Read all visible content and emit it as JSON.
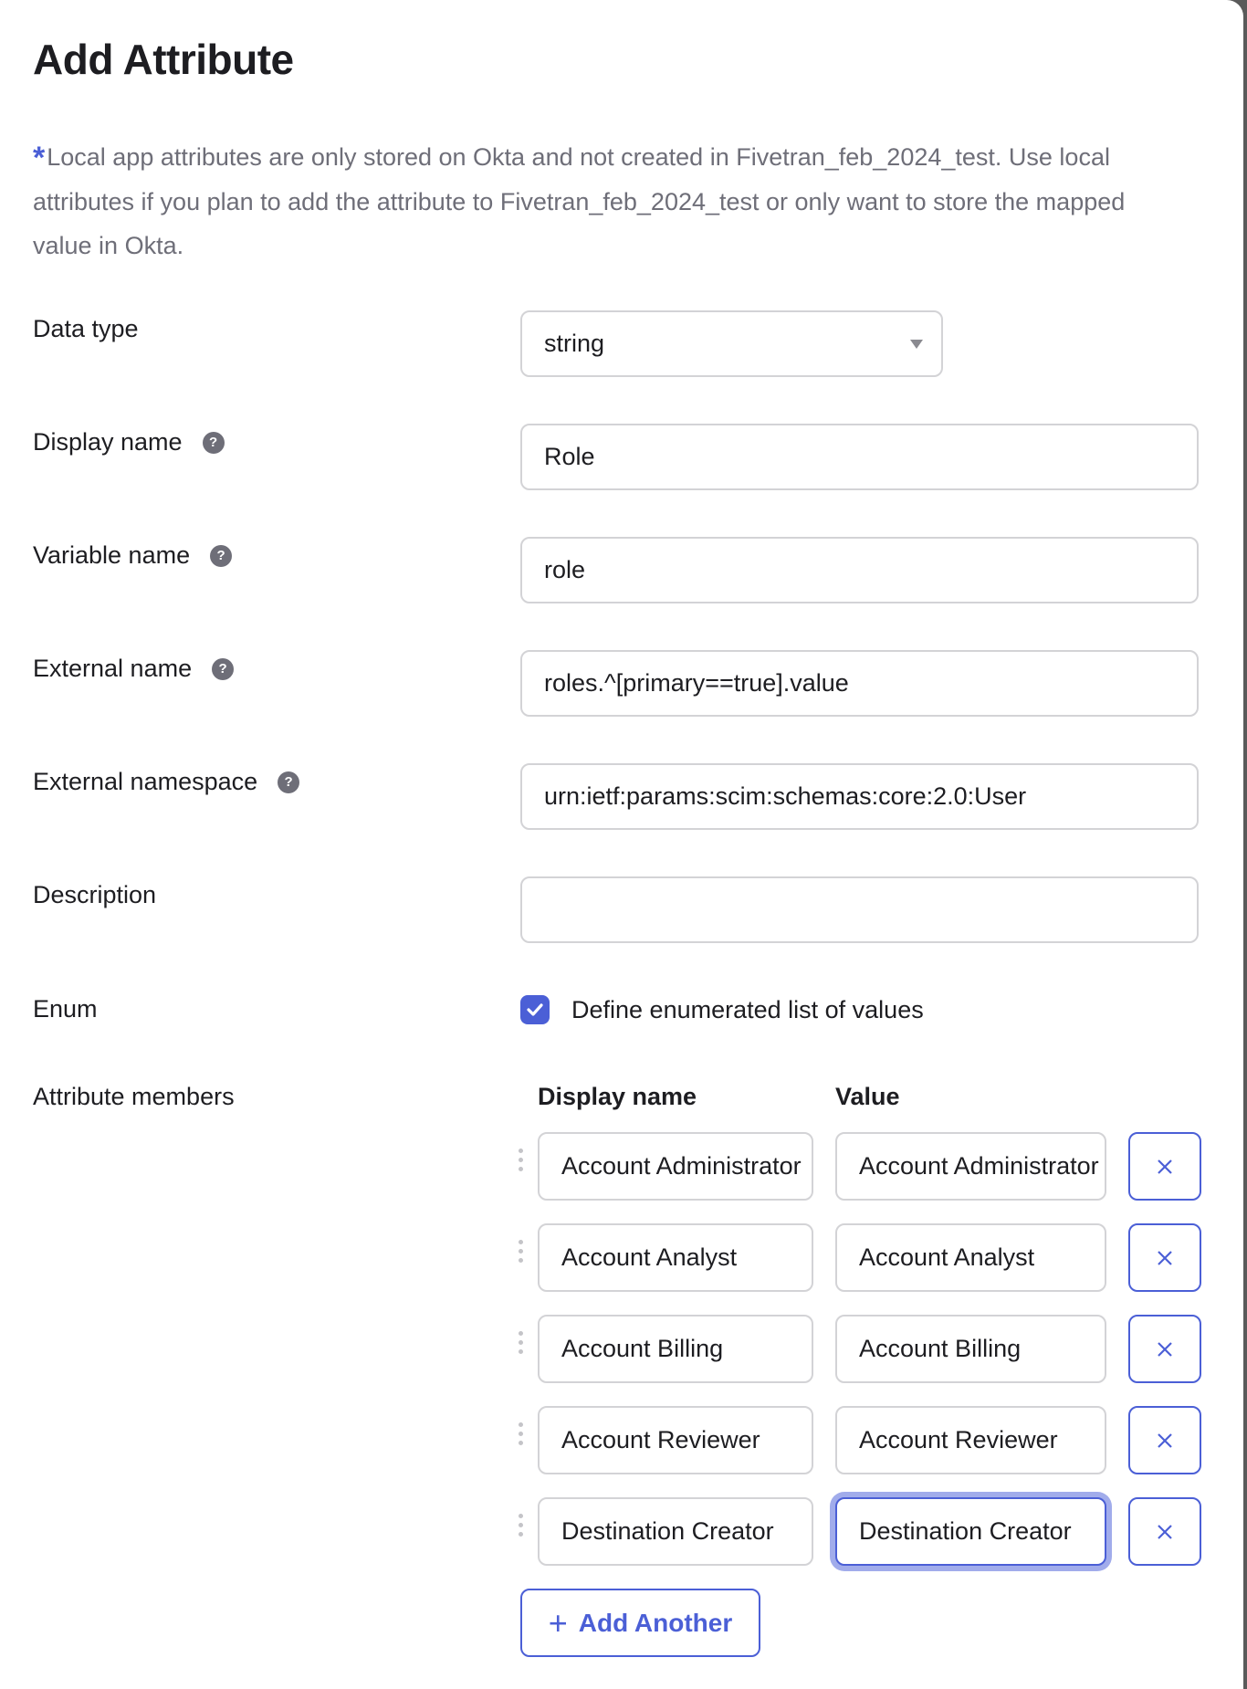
{
  "dialog": {
    "title": "Add Attribute",
    "note_marker": "*",
    "note": "Local app attributes are only stored on Okta and not created in Fivetran_feb_2024_test. Use local attributes if you plan to add the attribute to Fivetran_feb_2024_test or only want to store the mapped value in Okta."
  },
  "fields": {
    "data_type": {
      "label": "Data type",
      "value": "string"
    },
    "display_name": {
      "label": "Display name",
      "value": "Role",
      "help_icon": "?"
    },
    "variable_name": {
      "label": "Variable name",
      "value": "role",
      "help_icon": "?"
    },
    "external_name": {
      "label": "External name",
      "value": "roles.^[primary==true].value",
      "help_icon": "?"
    },
    "external_namespace": {
      "label": "External namespace",
      "value": "urn:ietf:params:scim:schemas:core:2.0:User",
      "help_icon": "?"
    },
    "description": {
      "label": "Description",
      "value": ""
    },
    "enum": {
      "label": "Enum",
      "checkbox_label": "Define enumerated list of values",
      "checked": true
    }
  },
  "attribute_members": {
    "label": "Attribute members",
    "col_display": "Display name",
    "col_value": "Value",
    "rows": [
      {
        "display": "Account Administrator",
        "value": "Account Administrator"
      },
      {
        "display": "Account Analyst",
        "value": "Account Analyst"
      },
      {
        "display": "Account Billing",
        "value": "Account Billing"
      },
      {
        "display": "Account Reviewer",
        "value": "Account Reviewer"
      },
      {
        "display": "Destination Creator",
        "value": "Destination Creator"
      }
    ],
    "add_label": "Add Another",
    "add_icon": "+"
  },
  "colors": {
    "accent": "#4b5fd6",
    "focus_ring": "#a1aceb",
    "muted_text": "#6e6e78"
  }
}
